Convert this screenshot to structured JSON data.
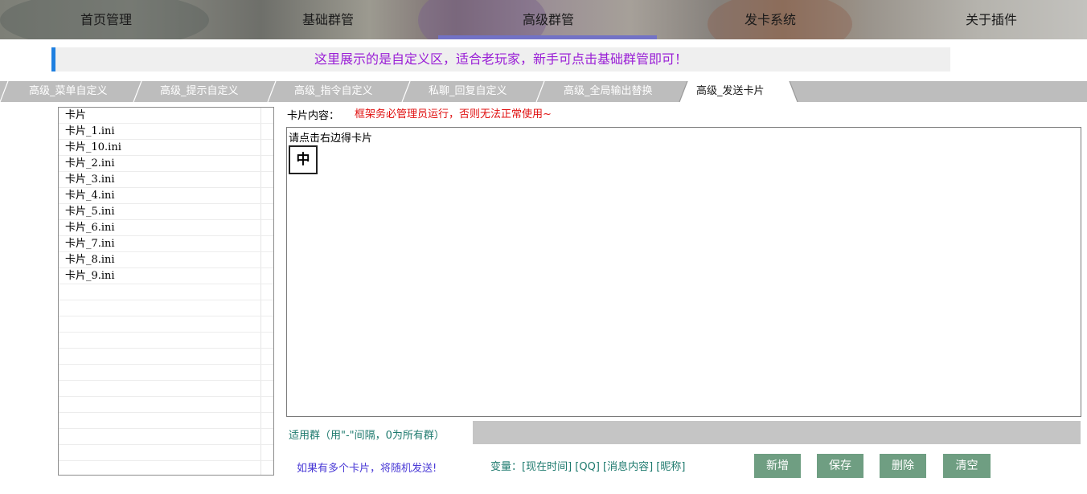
{
  "nav": {
    "items": [
      "首页管理",
      "基础群管",
      "高级群管",
      "发卡系统",
      "关于插件"
    ],
    "active_index": 2
  },
  "notice": {
    "text": "这里展示的是自定义区，适合老玩家，新手可点击基础群管即可！"
  },
  "tabs": {
    "items": [
      "高级_菜单自定义",
      "高级_提示自定义",
      "高级_指令自定义",
      "私聊_回复自定义",
      "高级_全局输出替换",
      "高级_发送卡片"
    ],
    "active_index": 5
  },
  "card_list": {
    "header": "卡片",
    "items": [
      "卡片_1.ini",
      "卡片_10.ini",
      "卡片_2.ini",
      "卡片_3.ini",
      "卡片_4.ini",
      "卡片_5.ini",
      "卡片_6.ini",
      "卡片_7.ini",
      "卡片_8.ini",
      "卡片_9.ini"
    ]
  },
  "content": {
    "label": "卡片内容：",
    "warning": "框架务必管理员运行，否则无法正常使用~",
    "editor_hint": "请点击右边得卡片",
    "char_button": "中"
  },
  "group": {
    "label": "适用群（用\"-\"间隔，0为所有群）",
    "value": ""
  },
  "footer": {
    "random_note": "如果有多个卡片，将随机发送!",
    "variables": "变量：[现在时间] [QQ] [消息内容] [昵称]"
  },
  "buttons": {
    "add": "新增",
    "save": "保存",
    "delete": "删除",
    "clear": "清空"
  },
  "colors": {
    "nav_active_line": "#7272c6",
    "notice_text": "#9a1fd6",
    "warning": "#e01010",
    "button_bg": "#6f9e82"
  }
}
